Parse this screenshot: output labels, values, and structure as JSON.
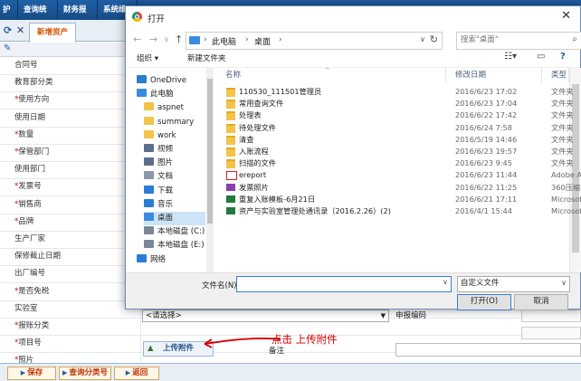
{
  "topnav": {
    "items": [
      "护",
      "查询统计",
      "财务报账",
      "系统维护"
    ]
  },
  "tabs": {
    "active": "新增资产"
  },
  "form": {
    "fields": [
      {
        "label": "合同号",
        "required": false
      },
      {
        "label": "教育部分类",
        "required": false
      },
      {
        "label": "使用方向",
        "required": true
      },
      {
        "label": "使用日期",
        "required": false
      },
      {
        "label": "数量",
        "required": true
      },
      {
        "label": "保管部门",
        "required": true
      },
      {
        "label": "使用部门",
        "required": false
      },
      {
        "label": "发票号",
        "required": true
      },
      {
        "label": "销售商",
        "required": true
      },
      {
        "label": "品牌",
        "required": true
      },
      {
        "label": "生产厂家",
        "required": false
      },
      {
        "label": "保修截止日期",
        "required": false
      },
      {
        "label": "出厂编号",
        "required": false
      },
      {
        "label": "是否免税",
        "required": true
      },
      {
        "label": "实验室",
        "required": false
      },
      {
        "label": "报账分类",
        "required": true
      },
      {
        "label": "项目号",
        "required": true
      },
      {
        "label": "照片",
        "required": true
      }
    ],
    "select_placeholder": "<请选择>",
    "right_label": "申报编码",
    "upload_label": "上传附件",
    "annotation": "点击 上传附件",
    "remark_label": "备注"
  },
  "bottom_buttons": [
    "保存",
    "查询分类号",
    "返回"
  ],
  "dialog": {
    "title": "打开",
    "breadcrumb": [
      "此电脑",
      "桌面"
    ],
    "search_placeholder": "搜索\"桌面\"",
    "toolbar": {
      "organize": "组织 ▾",
      "new_folder": "新建文件夹"
    },
    "sidebar": [
      {
        "label": "OneDrive",
        "icon": "cloud-icon",
        "color": "#2b7cd3"
      },
      {
        "label": "此电脑",
        "icon": "pc-icon",
        "color": "#3a8be0"
      },
      {
        "label": "aspnet",
        "icon": "folder-icon",
        "color": "#f2c44b"
      },
      {
        "label": "summary",
        "icon": "folder-icon",
        "color": "#f2c44b"
      },
      {
        "label": "work",
        "icon": "folder-icon",
        "color": "#f2c44b"
      },
      {
        "label": "视频",
        "icon": "video-icon",
        "color": "#5a6f8c"
      },
      {
        "label": "图片",
        "icon": "pictures-icon",
        "color": "#5a6f8c"
      },
      {
        "label": "文档",
        "icon": "documents-icon",
        "color": "#8a98ac"
      },
      {
        "label": "下载",
        "icon": "download-icon",
        "color": "#2b7cd3"
      },
      {
        "label": "音乐",
        "icon": "music-icon",
        "color": "#2b7cd3"
      },
      {
        "label": "桌面",
        "icon": "desktop-icon",
        "color": "#3a8be0",
        "selected": true
      },
      {
        "label": "本地磁盘 (C:)",
        "icon": "drive-icon",
        "color": "#7a8797"
      },
      {
        "label": "本地磁盘 (E:)",
        "icon": "drive-icon",
        "color": "#7a8797"
      },
      {
        "label": "网络",
        "icon": "network-icon",
        "color": "#2b7cd3"
      }
    ],
    "columns": {
      "name": "名称",
      "date": "修改日期",
      "type": "类型"
    },
    "files": [
      {
        "name": "110530_111501管理员",
        "date": "2016/6/23 17:02",
        "type": "文件夹",
        "icon": "folder-icon"
      },
      {
        "name": "常用查询文件",
        "date": "2016/6/23 17:04",
        "type": "文件夹",
        "icon": "folder-icon"
      },
      {
        "name": "处理表",
        "date": "2016/6/22 17:42",
        "type": "文件夹",
        "icon": "folder-icon"
      },
      {
        "name": "待处理文件",
        "date": "2016/6/24 7:58",
        "type": "文件夹",
        "icon": "folder-icon"
      },
      {
        "name": "清查",
        "date": "2016/5/19 14:46",
        "type": "文件夹",
        "icon": "folder-icon"
      },
      {
        "name": "入账流程",
        "date": "2016/6/23 19:57",
        "type": "文件夹",
        "icon": "folder-icon"
      },
      {
        "name": "扫描的文件",
        "date": "2016/6/23 9:45",
        "type": "文件夹",
        "icon": "folder-icon"
      },
      {
        "name": "ereport",
        "date": "2016/6/23 11:44",
        "type": "Adobe Acrobat",
        "icon": "pdf-icon"
      },
      {
        "name": "发票照片",
        "date": "2016/6/22 11:25",
        "type": "360压缩 RAR 文",
        "icon": "rar-icon"
      },
      {
        "name": "重复入账模板-6月21日",
        "date": "2016/6/21 17:11",
        "type": "Microsoft Excel",
        "icon": "excel-icon"
      },
      {
        "name": "资产与实验室管理处通讯录（2016.2.26）(2)",
        "date": "2016/4/1 15:44",
        "type": "Microsoft Excel",
        "icon": "excel-icon"
      }
    ],
    "filename_label": "文件名(N):",
    "filename_value": "",
    "filetype_value": "自定义文件",
    "open_button": "打开(O)",
    "cancel_button": "取消"
  }
}
